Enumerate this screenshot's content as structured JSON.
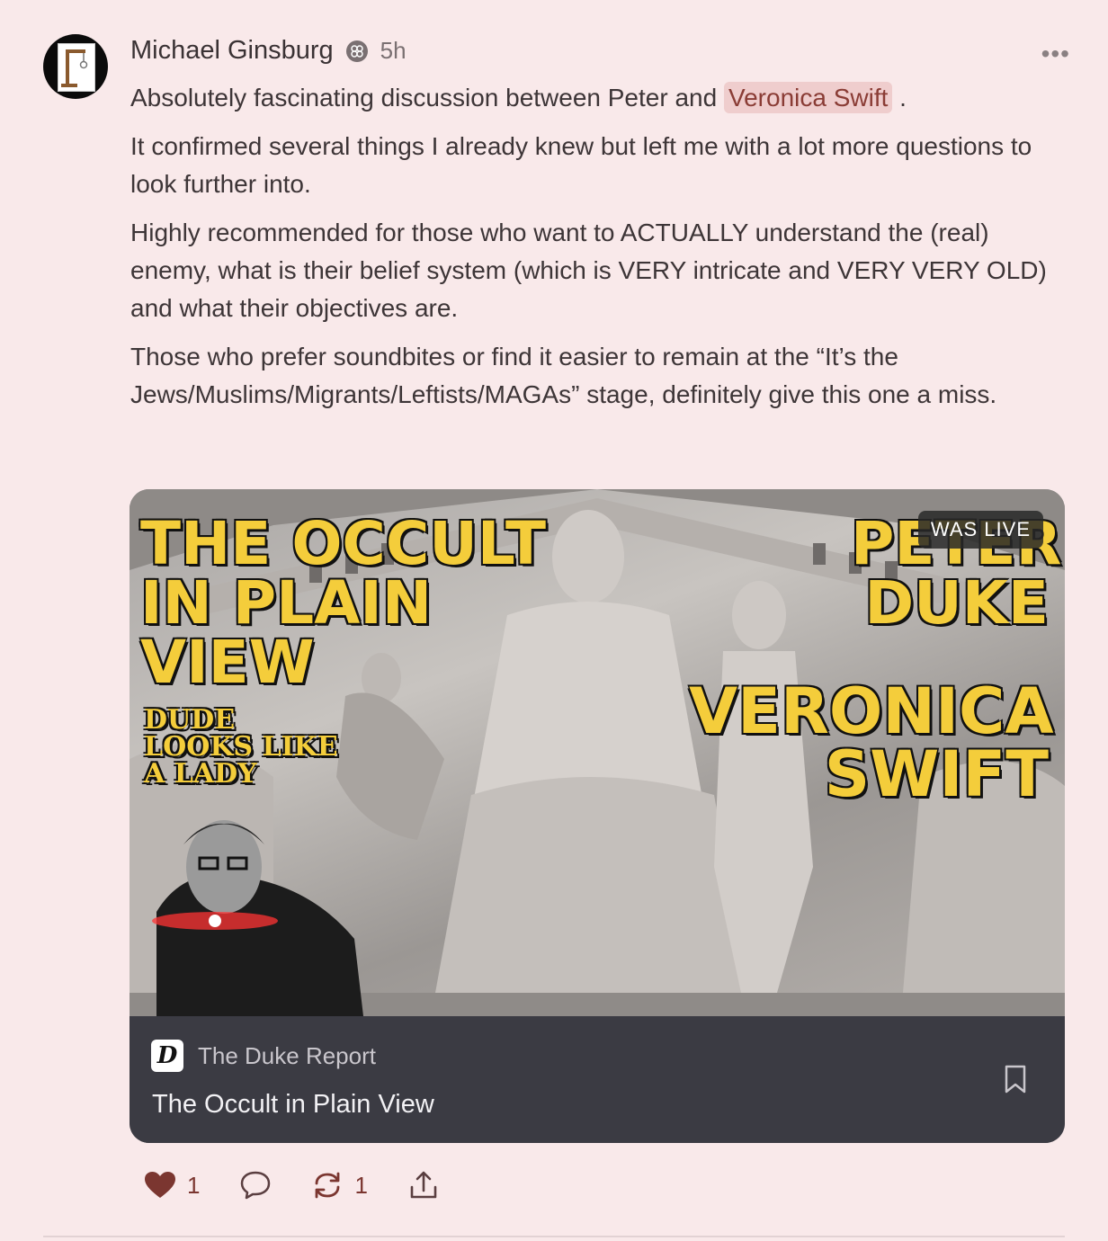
{
  "post": {
    "author": "Michael Ginsburg",
    "time": "5h",
    "more_label": "•••",
    "paragraphs": {
      "p1_before": "Absolutely fascinating discussion between Peter and ",
      "p1_mention": "Veronica Swift",
      "p1_after": " .",
      "p2": "It confirmed several things I already knew but left me with a lot more questions to look further into.",
      "p3": "Highly recommended for those who want to ACTUALLY understand the (real) enemy, what is their belief system (which is VERY intricate and VERY VERY OLD) and what their objectives are.",
      "p4": "Those who prefer soundbites or find it easier to remain at the “It’s the Jews/Muslims/Migrants/Leftists/MAGAs” stage, definitely give this one a miss."
    }
  },
  "card": {
    "thumbnail": {
      "title_left": "THE OCCULT IN PLAIN VIEW",
      "subtitle_left": "DUDE LOOKS LIKE A LADY",
      "name_right_1": "PETER DUKE",
      "name_right_2": "VERONICA SWIFT",
      "live_badge": "WAS LIVE"
    },
    "publication": "The Duke Report",
    "publication_logo_letter": "D",
    "title": "The Occult in Plain View"
  },
  "actions": {
    "like_count": "1",
    "restack_count": "1"
  },
  "colors": {
    "background": "#f9e9ea",
    "accent": "#7b3630",
    "mention_bg": "#efcdcd",
    "card_bg": "#3b3b43",
    "thumb_text": "#f4cd3b"
  },
  "icons": [
    "avatar-gallows-icon",
    "verified-badge-icon",
    "more-icon",
    "bookmark-icon",
    "heart-icon",
    "comment-icon",
    "restack-icon",
    "share-icon"
  ]
}
